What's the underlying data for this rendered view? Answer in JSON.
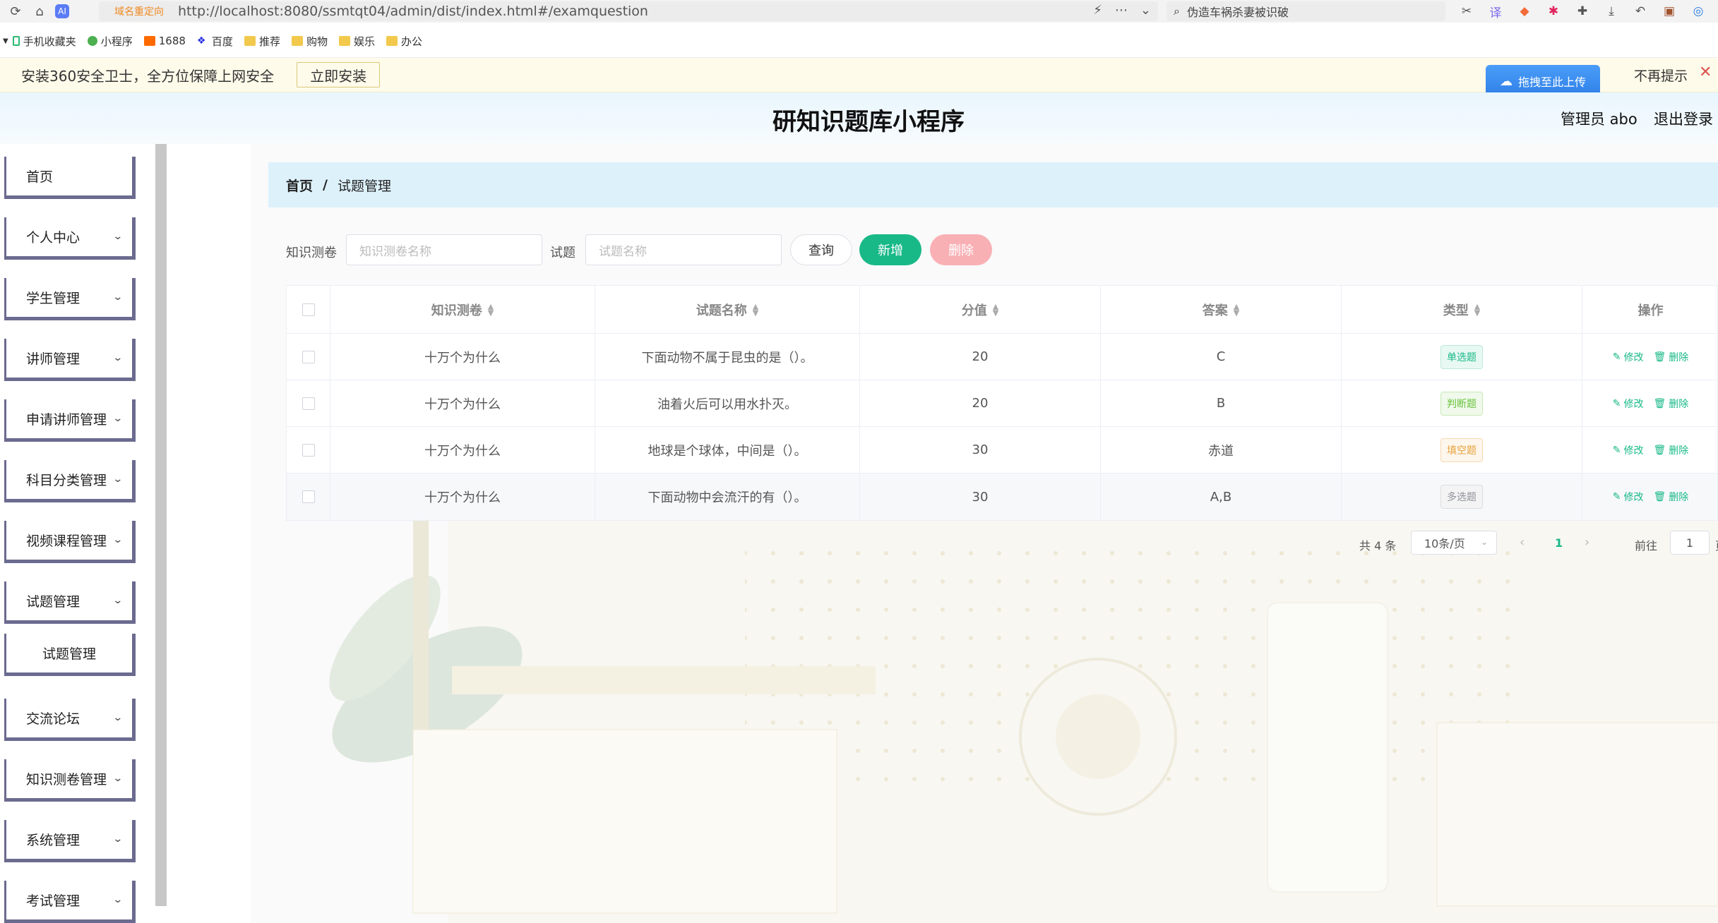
{
  "browser": {
    "redirect_tag": "域名重定向",
    "url": "http://localhost:8080/ssmtqt04/admin/dist/index.html#/examquestion",
    "search_text": "伪造车祸杀妻被识破"
  },
  "bookmarks": [
    "手机收藏夹",
    "小程序",
    "1688",
    "百度",
    "推荐",
    "购物",
    "娱乐",
    "办公"
  ],
  "notice": {
    "text": "安装360安全卫士，全方位保障上网安全",
    "install_label": "立即安装",
    "upload_label": "拖拽至此上传",
    "dont_show_label": "不再提示",
    "close_glyph": "✕"
  },
  "header": {
    "title": "研知识题库小程序",
    "admin_label": "管理员 abo",
    "logout_label": "退出登录"
  },
  "sidebar": {
    "items": [
      {
        "label": "首页",
        "has_children": false
      },
      {
        "label": "个人中心",
        "has_children": true
      },
      {
        "label": "学生管理",
        "has_children": true
      },
      {
        "label": "讲师管理",
        "has_children": true
      },
      {
        "label": "申请讲师管理",
        "has_children": true
      },
      {
        "label": "科目分类管理",
        "has_children": true
      },
      {
        "label": "视频课程管理",
        "has_children": true
      },
      {
        "label": "试题管理",
        "has_children": true
      },
      {
        "label": "试题管理",
        "has_children": false,
        "submenu": true
      },
      {
        "label": "交流论坛",
        "has_children": true
      },
      {
        "label": "知识测卷管理",
        "has_children": true
      },
      {
        "label": "系统管理",
        "has_children": true
      },
      {
        "label": "考试管理",
        "has_children": true
      }
    ]
  },
  "breadcrumb": {
    "home": "首页",
    "separator": "/",
    "current": "试题管理"
  },
  "filter": {
    "paper_label": "知识测卷",
    "paper_placeholder": "知识测卷名称",
    "question_label": "试题",
    "question_placeholder": "试题名称",
    "query_label": "查询",
    "add_label": "新增",
    "delete_label": "删除"
  },
  "table": {
    "headers": [
      "知识测卷",
      "试题名称",
      "分值",
      "答案",
      "类型",
      "操作"
    ],
    "edit_label": "修改",
    "delete_label": "删除",
    "rows": [
      {
        "paper": "十万个为什么",
        "question": "下面动物不属于昆虫的是（）。",
        "score": "20",
        "answer": "C",
        "type": "单选题",
        "type_kind": "single"
      },
      {
        "paper": "十万个为什么",
        "question": "油着火后可以用水扑灭。",
        "score": "20",
        "answer": "B",
        "type": "判断题",
        "type_kind": "judge"
      },
      {
        "paper": "十万个为什么",
        "question": "地球是个球体，中间是（）。",
        "score": "30",
        "answer": "赤道",
        "type": "填空题",
        "type_kind": "fill"
      },
      {
        "paper": "十万个为什么",
        "question": "下面动物中会流汗的有（）。",
        "score": "30",
        "answer": "A,B",
        "type": "多选题",
        "type_kind": "multi"
      }
    ]
  },
  "pagination": {
    "total": "共 4 条",
    "page_size": "10条/页",
    "current_page": "1",
    "goto_label": "前往",
    "goto_value": "1",
    "page_unit": "页"
  },
  "colors": {
    "accent": "#18b987",
    "delete_button": "#f9b0b5",
    "breadcrumb_bg": "#ddf1fb",
    "sidebar_border": "#6b6a8f"
  }
}
